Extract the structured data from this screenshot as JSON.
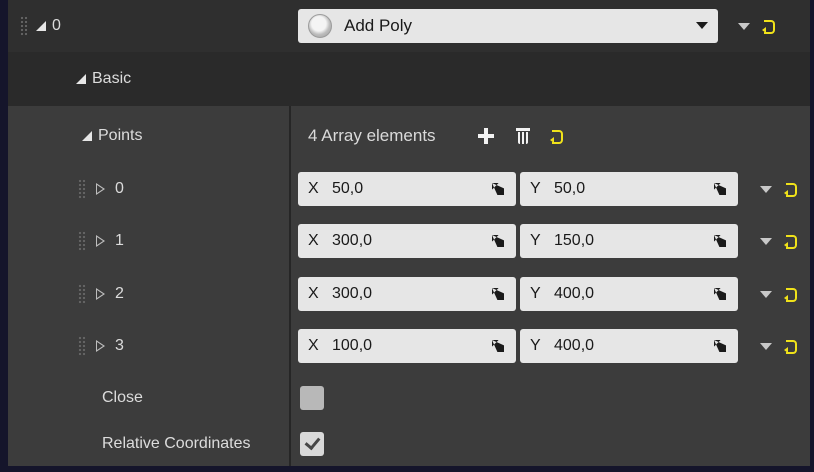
{
  "header": {
    "index_label": "0",
    "selected_shape": "Add Poly"
  },
  "basic": {
    "label": "Basic"
  },
  "points": {
    "label": "Points",
    "count_text": "4 Array elements",
    "items": [
      {
        "index": "0",
        "x": "50,0",
        "y": "50,0"
      },
      {
        "index": "1",
        "x": "300,0",
        "y": "150,0"
      },
      {
        "index": "2",
        "x": "300,0",
        "y": "400,0"
      },
      {
        "index": "3",
        "x": "100,0",
        "y": "400,0"
      }
    ],
    "axis_x": "X",
    "axis_y": "Y"
  },
  "close": {
    "label": "Close",
    "checked": false
  },
  "relative": {
    "label": "Relative Coordinates",
    "checked": true
  },
  "icons": {
    "reset": "reset-to-default-icon",
    "add": "plus-icon",
    "delete": "trash-icon",
    "expand": "triangle-expand-icon"
  },
  "colors": {
    "panel_bg": "#3c3c3c",
    "header_bg": "#2f2f2f",
    "field_bg": "#e6e6e6",
    "reset_accent": "#f0e21a"
  }
}
